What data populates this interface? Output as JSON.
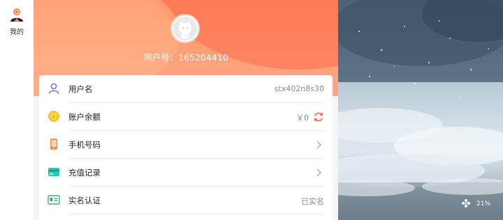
{
  "nav": {
    "label": "我的",
    "icon": "user-icon"
  },
  "header": {
    "user_id": "用户号：165204410",
    "avatar_icon": "avatar-cat-icon"
  },
  "rows": [
    {
      "label": "用户名",
      "value": "stx402n8s30",
      "icon": "person-icon"
    },
    {
      "label": "账户余额",
      "value": "￥0",
      "icon": "coin-icon",
      "trail_icon": "refresh-icon"
    },
    {
      "label": "手机号码",
      "value": "",
      "icon": "phone-icon",
      "trail_icon": "chevron-right-icon"
    },
    {
      "label": "充值记录",
      "value": "",
      "icon": "card-icon",
      "trail_icon": "chevron-right-icon"
    },
    {
      "label": "实名认证",
      "value": "已实名",
      "icon": "id-card-icon"
    }
  ],
  "scene": {
    "indicator": "21%",
    "icon": "flower-icon"
  },
  "colors": {
    "header": "#ff8c5e",
    "accent_refresh": "#ff6a4c",
    "nav_icon": "#ff7a4c"
  }
}
